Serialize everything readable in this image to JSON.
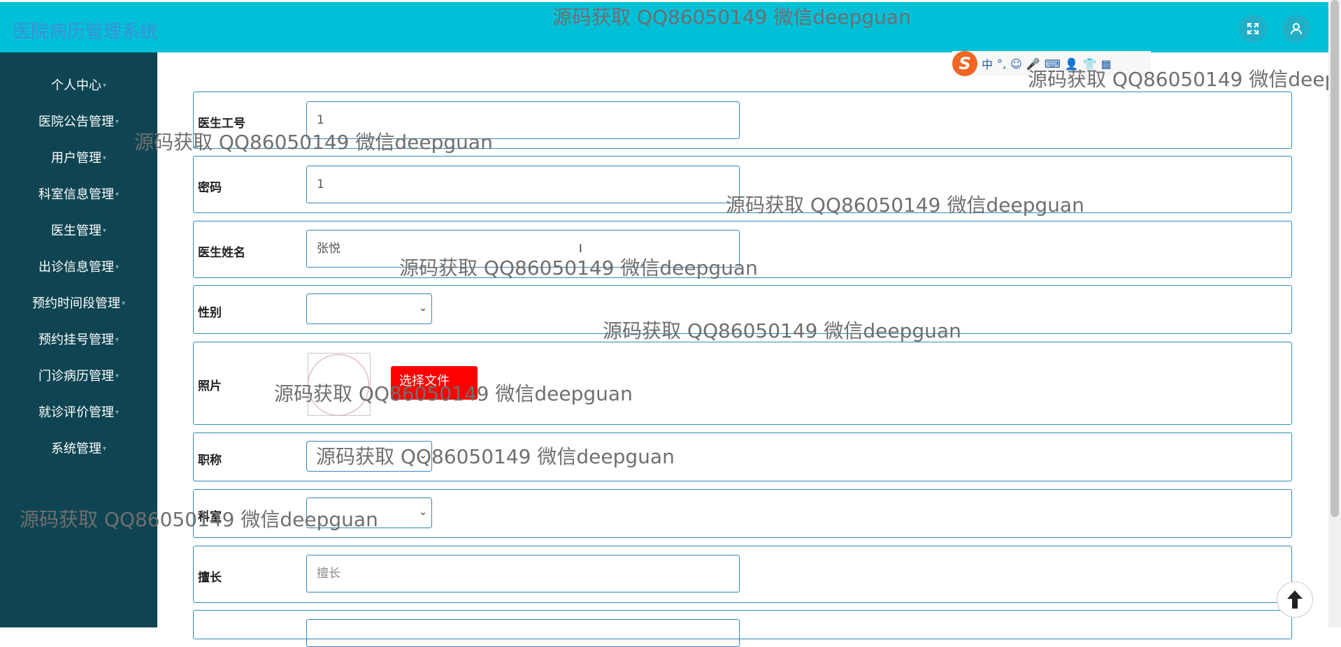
{
  "header": {
    "title": "医院病历管理系统",
    "icons": [
      "fullscreen-icon",
      "user-icon"
    ]
  },
  "sidebar": {
    "items": [
      {
        "label": "个人中心"
      },
      {
        "label": "医院公告管理"
      },
      {
        "label": "用户管理"
      },
      {
        "label": "科室信息管理"
      },
      {
        "label": "医生管理"
      },
      {
        "label": "出诊信息管理"
      },
      {
        "label": "预约时间段管理"
      },
      {
        "label": "预约挂号管理"
      },
      {
        "label": "门诊病历管理"
      },
      {
        "label": "就诊评价管理"
      },
      {
        "label": "系统管理"
      }
    ]
  },
  "form": {
    "doctor_id": {
      "label": "医生工号",
      "value": "1"
    },
    "password": {
      "label": "密码",
      "value": "1"
    },
    "doctor_name": {
      "label": "医生姓名",
      "value": "张悦"
    },
    "gender": {
      "label": "性别",
      "value": ""
    },
    "photo": {
      "label": "照片",
      "button": "选择文件"
    },
    "title": {
      "label": "职称",
      "value": ""
    },
    "department": {
      "label": "科室",
      "value": ""
    },
    "specialty": {
      "label": "擅长",
      "placeholder": "擅长"
    }
  },
  "ime": {
    "mode": "中",
    "punct": "°,"
  },
  "watermark": "源码获取 QQ86050149 微信deepguan",
  "colors": {
    "header_bg": "#00c0d8",
    "sidebar_bg": "#0f4552",
    "accent_border": "#2e8db8",
    "file_button": "#ff0000"
  }
}
